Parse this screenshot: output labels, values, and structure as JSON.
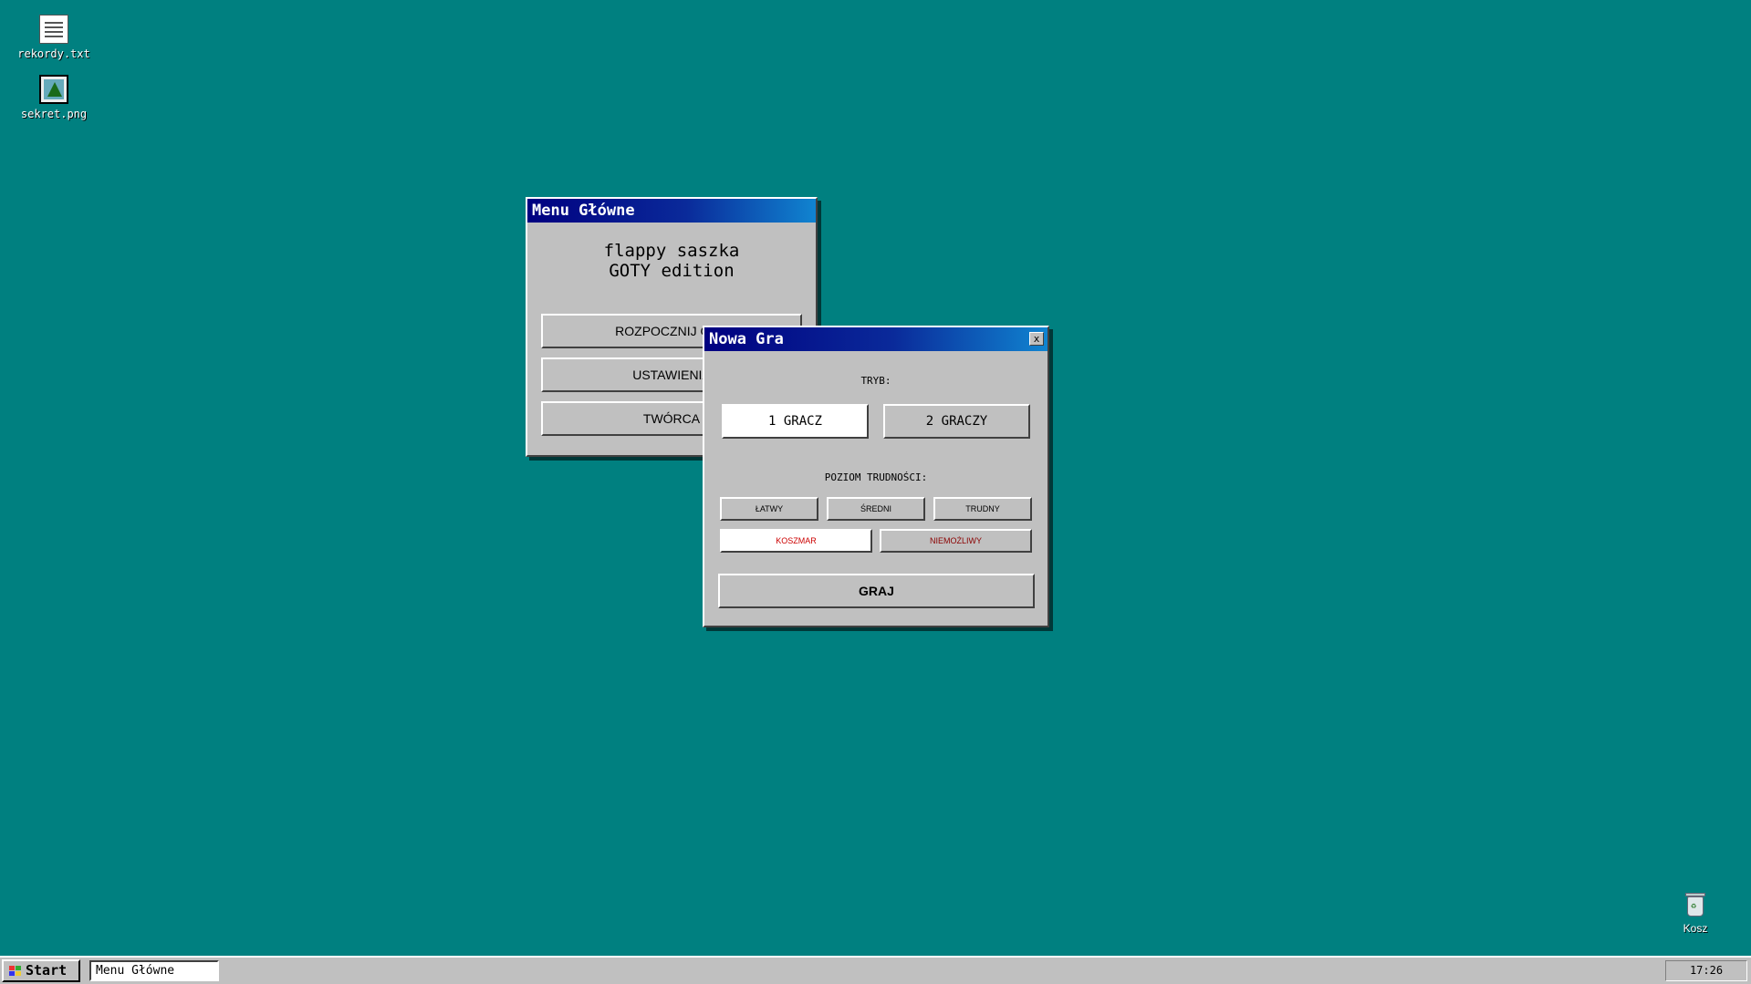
{
  "desktop": {
    "icons": [
      {
        "label": "rekordy.txt",
        "icon": "text-file-icon"
      },
      {
        "label": "sekret.png",
        "icon": "image-file-icon"
      }
    ],
    "recycle_bin": {
      "label": "Kosz",
      "icon": "recycle-bin-icon"
    }
  },
  "main_menu": {
    "title": "Menu Główne",
    "game_title_line1": "flappy saszka",
    "game_title_line2": "GOTY edition",
    "buttons": [
      "ROZPOCZNIJ GRĘ",
      "USTAWIENIA",
      "TWÓRCA"
    ]
  },
  "new_game": {
    "title": "Nowa Gra",
    "close_label": "x",
    "mode_label": "TRYB:",
    "mode_options": [
      "1 GRACZ",
      "2 GRACZY"
    ],
    "selected_mode": "1 GRACZ",
    "difficulty_label": "POZIOM TRUDNOŚCI:",
    "difficulty_row1": [
      "ŁATWY",
      "ŚREDNI",
      "TRUDNY"
    ],
    "difficulty_row2": [
      "KOSZMAR",
      "NIEMOŻLIWY"
    ],
    "selected_difficulty": "KOSZMAR",
    "play_label": "GRAJ"
  },
  "taskbar": {
    "start_label": "Start",
    "active_task": "Menu Główne",
    "clock": "17:26"
  },
  "colors": {
    "desktop": "#008080",
    "title_bar_start": "#000080",
    "title_bar_end": "#1084d0",
    "window_face": "#c0c0c0",
    "danger_text": "#cc0000"
  }
}
